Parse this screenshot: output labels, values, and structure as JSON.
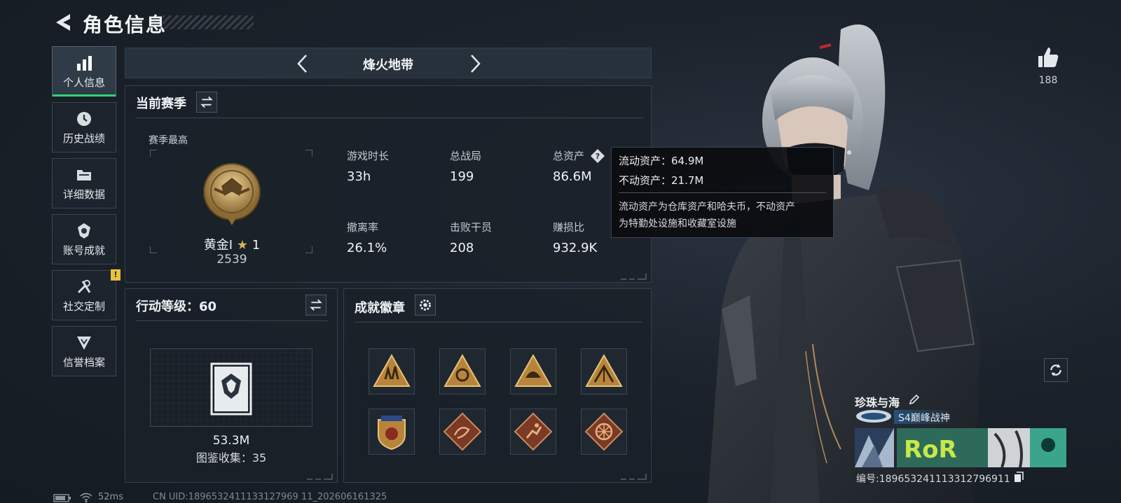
{
  "header": {
    "title": "角色信息"
  },
  "sidebar": {
    "items": [
      {
        "label": "个人信息",
        "icon": "bar-chart-icon",
        "active": true
      },
      {
        "label": "历史战绩",
        "icon": "history-clock-icon"
      },
      {
        "label": "详细数据",
        "icon": "folder-icon"
      },
      {
        "label": "账号成就",
        "icon": "achievement-icon"
      },
      {
        "label": "社交定制",
        "icon": "wrench-icon",
        "badge": "!"
      },
      {
        "label": "信誉档案",
        "icon": "shield-icon"
      }
    ]
  },
  "mode": {
    "name": "烽火地带"
  },
  "season": {
    "title": "当前赛季",
    "best_label": "赛季最高",
    "rank": {
      "tier": "黄金Ⅰ",
      "stars": "1",
      "score": "2539"
    },
    "stats": [
      {
        "label": "游戏时长",
        "value": "33h"
      },
      {
        "label": "总战局",
        "value": "199"
      },
      {
        "label": "总资产",
        "value": "86.6M"
      },
      {
        "label": "撤离率",
        "value": "26.1%"
      },
      {
        "label": "击败干员",
        "value": "208"
      },
      {
        "label": "赚损比",
        "value": "932.9K"
      }
    ]
  },
  "tooltip": {
    "liquid": "流动资产：64.9M",
    "fixed": "不动资产：21.7M",
    "desc_line1": "流动资产为仓库资产和哈夫币，不动资产",
    "desc_line2": "为特勤处设施和收藏室设施"
  },
  "level": {
    "title": "行动等级：60",
    "value": "53.3M",
    "codex": "图鉴收集：35"
  },
  "badges": {
    "title": "成就徽章",
    "items": [
      "badge-soldiers",
      "badge-pyramid",
      "badge-helmet",
      "badge-mountain",
      "badge-shield-stars",
      "badge-dragon",
      "badge-runner",
      "badge-wheel"
    ]
  },
  "player": {
    "likes": "188",
    "name": "珍珠与海",
    "title": "S4巅峰战神",
    "id": "编号:1896532411133127969​11",
    "banner_text": "RoR"
  },
  "status": {
    "ping": "52ms",
    "uid": "CN UID:1896532411133127969 11_202606161325"
  },
  "colors": {
    "accent": "#2fd47a",
    "gold": "#c9a25a",
    "warning": "#e8c23a"
  }
}
